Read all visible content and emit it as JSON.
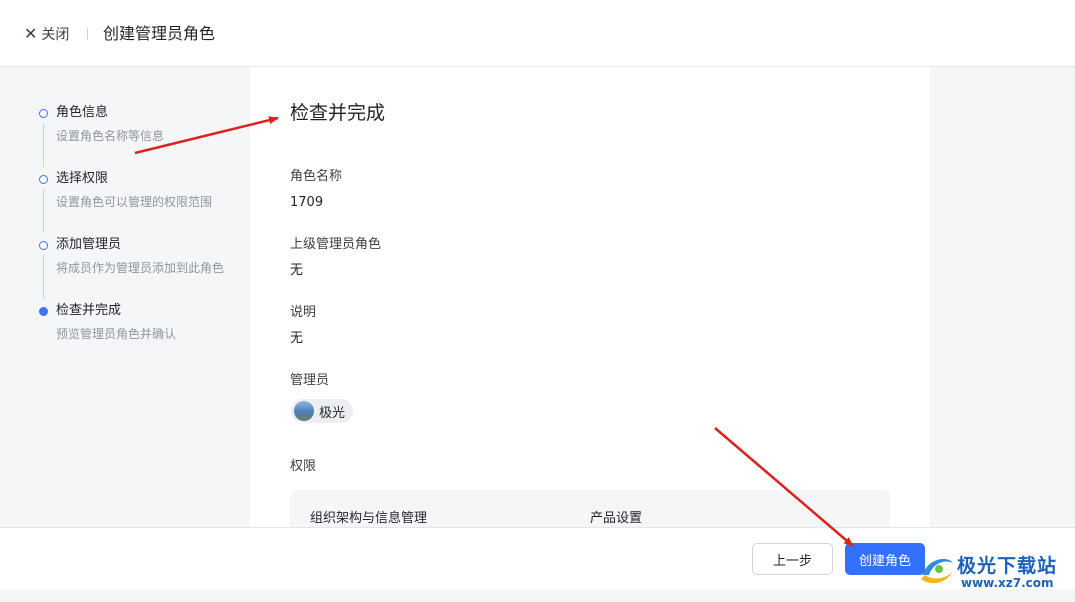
{
  "header": {
    "close_icon": "close-icon",
    "close_label": "关闭",
    "title": "创建管理员角色"
  },
  "steps": [
    {
      "title": "角色信息",
      "desc": "设置角色名称等信息",
      "state": "done"
    },
    {
      "title": "选择权限",
      "desc": "设置角色可以管理的权限范围",
      "state": "done"
    },
    {
      "title": "添加管理员",
      "desc": "将成员作为管理员添加到此角色",
      "state": "done"
    },
    {
      "title": "检查并完成",
      "desc": "预览管理员角色并确认",
      "state": "active"
    }
  ],
  "review": {
    "title": "检查并完成",
    "role_name_label": "角色名称",
    "role_name_value": "1709",
    "parent_role_label": "上级管理员角色",
    "parent_role_value": "无",
    "description_label": "说明",
    "description_value": "无",
    "admins_label": "管理员",
    "admins": [
      {
        "name": "极光"
      }
    ],
    "permissions_label": "权限",
    "permissions": [
      "组织架构与信息管理",
      "产品设置"
    ]
  },
  "footer": {
    "prev_label": "上一步",
    "create_label": "创建角色"
  },
  "watermark": {
    "text": "极光下载站",
    "url": "www.xz7.com"
  },
  "colors": {
    "accent": "#3370ff",
    "step_dot": "#3b73f0",
    "annotation_arrow": "#d9231f",
    "watermark": "#1b62b8"
  }
}
